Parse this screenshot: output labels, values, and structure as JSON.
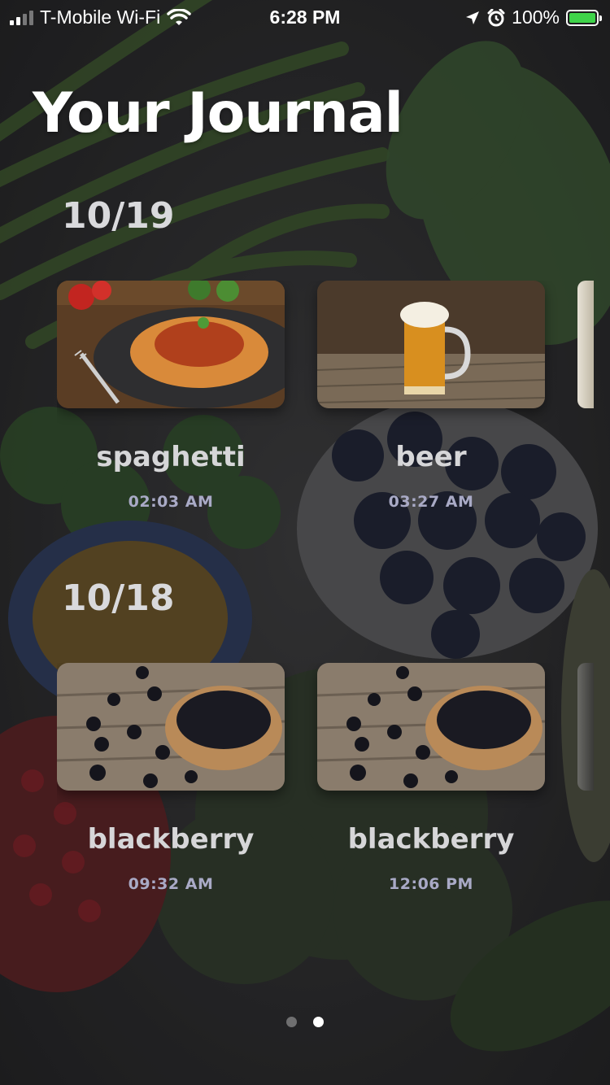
{
  "status_bar": {
    "carrier": "T-Mobile Wi-Fi",
    "time": "6:28 PM",
    "battery": "100%",
    "battery_level": 1.0,
    "icons": [
      "signal-icon",
      "wifi-icon",
      "location-icon",
      "alarm-icon",
      "battery-icon"
    ]
  },
  "page": {
    "title": "Your Journal"
  },
  "sections": [
    {
      "date": "10/19",
      "entries": [
        {
          "name": "spaghetti",
          "time": "02:03 AM",
          "image": "spaghetti-photo"
        },
        {
          "name": "beer",
          "time": "03:27 AM",
          "image": "beer-photo"
        }
      ]
    },
    {
      "date": "10/18",
      "entries": [
        {
          "name": "blackberry",
          "time": "09:32 AM",
          "image": "blackberry-photo"
        },
        {
          "name": "blackberry",
          "time": "12:06 PM",
          "image": "blackberry-photo"
        }
      ]
    }
  ],
  "pagination": {
    "total": 2,
    "active": 2
  },
  "colors": {
    "date": "#d9d9dc",
    "entry_name": "#d6d6d8",
    "entry_time": "#a9aac6",
    "battery": "#3fd44a"
  }
}
